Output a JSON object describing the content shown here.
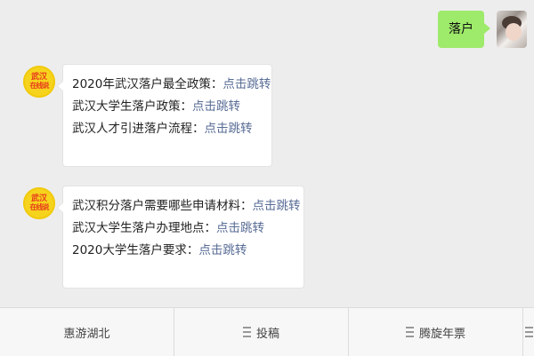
{
  "outgoing": {
    "text": "落户"
  },
  "bot_avatar": {
    "line1": "武汉",
    "line2": "在线说"
  },
  "messages": [
    {
      "lines": [
        {
          "text": "2020年武汉落户最全政策：",
          "link": "点击跳转"
        },
        {
          "text": "武汉大学生落户政策：",
          "link": "点击跳转"
        },
        {
          "text": "武汉人才引进落户流程：",
          "link": "点击跳转"
        }
      ]
    },
    {
      "lines": [
        {
          "text": "武汉积分落户需要哪些申请材料：",
          "link": "点击跳转"
        },
        {
          "text": "武汉大学生落户办理地点：",
          "link": "点击跳转"
        },
        {
          "text": "2020大学生落户要求：",
          "link": "点击跳转"
        }
      ]
    }
  ],
  "menu": {
    "items": [
      {
        "label": "惠游湖北",
        "icon": ""
      },
      {
        "label": "投稿",
        "icon": "menu-list-icon"
      },
      {
        "label": "腾旋年票",
        "icon": "menu-list-icon"
      },
      {
        "label": "",
        "icon": "menu-list-icon"
      }
    ]
  }
}
